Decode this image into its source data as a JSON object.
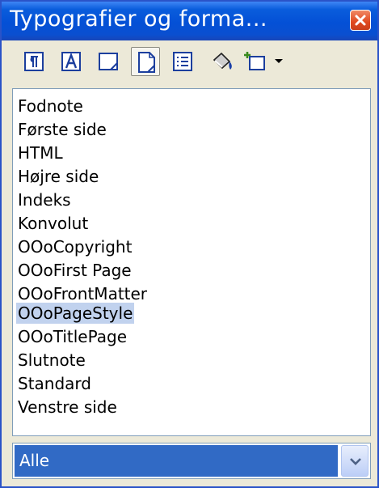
{
  "window": {
    "title": "Typografier og forma..."
  },
  "toolbar": {
    "buttons": [
      {
        "name": "paragraph-styles",
        "icon": "paragraph-styles-icon"
      },
      {
        "name": "character-styles",
        "icon": "character-styles-icon"
      },
      {
        "name": "frame-styles",
        "icon": "frame-styles-icon"
      },
      {
        "name": "page-styles",
        "icon": "page-styles-icon",
        "active": true
      },
      {
        "name": "list-styles",
        "icon": "list-styles-icon"
      },
      {
        "name": "fill-format-mode",
        "icon": "paint-bucket-icon"
      },
      {
        "name": "new-style-from-selection",
        "icon": "new-style-icon"
      }
    ]
  },
  "styles_list": {
    "items": [
      "Fodnote",
      "Første side",
      "HTML",
      "Højre side",
      "Indeks",
      "Konvolut",
      "OOoCopyright",
      "OOoFirst Page",
      "OOoFrontMatter",
      "OOoPageStyle",
      "OOoTitlePage",
      "Slutnote",
      "Standard",
      "Venstre side"
    ],
    "selected": "OOoPageStyle"
  },
  "filter": {
    "value": "Alle"
  },
  "colors": {
    "titlebar": "#0a4fd0",
    "selection": "#c1d2ee",
    "combo_highlight": "#316ac5",
    "close_button": "#e0491f"
  }
}
